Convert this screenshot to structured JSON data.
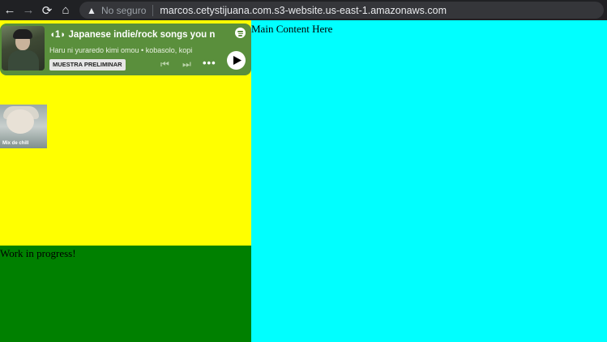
{
  "browser": {
    "back_icon": "←",
    "forward_icon": "→",
    "reload_icon": "⟳",
    "home_icon": "⌂",
    "warning_icon": "▲",
    "security_label": "No seguro",
    "url": "marcos.cetystijuana.com.s3-website.us-east-1.amazonaws.com"
  },
  "spotify": {
    "title": "◖1◗ Japanese indie/rock songs you n",
    "artists": "Haru ni yuraredo kimi omou  •  kobasolo, kopi",
    "preview_label": "MUESTRA PRELIMINAR",
    "prev_icon": "⏮",
    "next_icon": "⏭",
    "more_icon": "•••",
    "accent_color": "#5a8f3c"
  },
  "thumbnail": {
    "label": "Mix de chill"
  },
  "sidebar": {
    "footer_text": "Work in progress!"
  },
  "main": {
    "text": "Main Content Here"
  },
  "colors": {
    "sidebar_top": "#ffff00",
    "sidebar_bottom": "#008000",
    "main": "#00ffff"
  }
}
